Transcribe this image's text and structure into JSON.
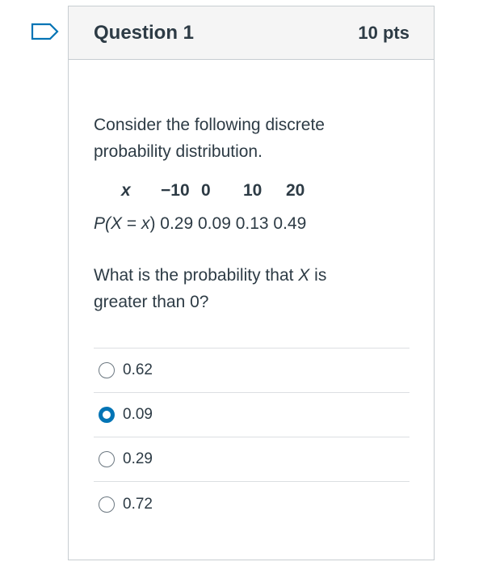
{
  "question": {
    "title": "Question 1",
    "points": "10 pts",
    "prompt": "Consider the following discrete probability distribution.",
    "distribution": {
      "x_label": "x",
      "x_values": [
        "−10",
        "0",
        "10",
        "20"
      ],
      "p_label_open": "P(",
      "p_label_x": "X",
      "p_label_mid": " = ",
      "p_label_x2": "x",
      "p_label_close": ")",
      "p_values": "0.29 0.09 0.13 0.49"
    },
    "ask_pre": "What is the probability that ",
    "ask_var": "X",
    "ask_post": " is greater than 0?"
  },
  "answers": [
    {
      "label": "0.62",
      "selected": false
    },
    {
      "label": "0.09",
      "selected": true
    },
    {
      "label": "0.29",
      "selected": false
    },
    {
      "label": "0.72",
      "selected": false
    }
  ],
  "colors": {
    "accent": "#0374b5",
    "text": "#2d3b45",
    "border": "#c7cdd1"
  }
}
